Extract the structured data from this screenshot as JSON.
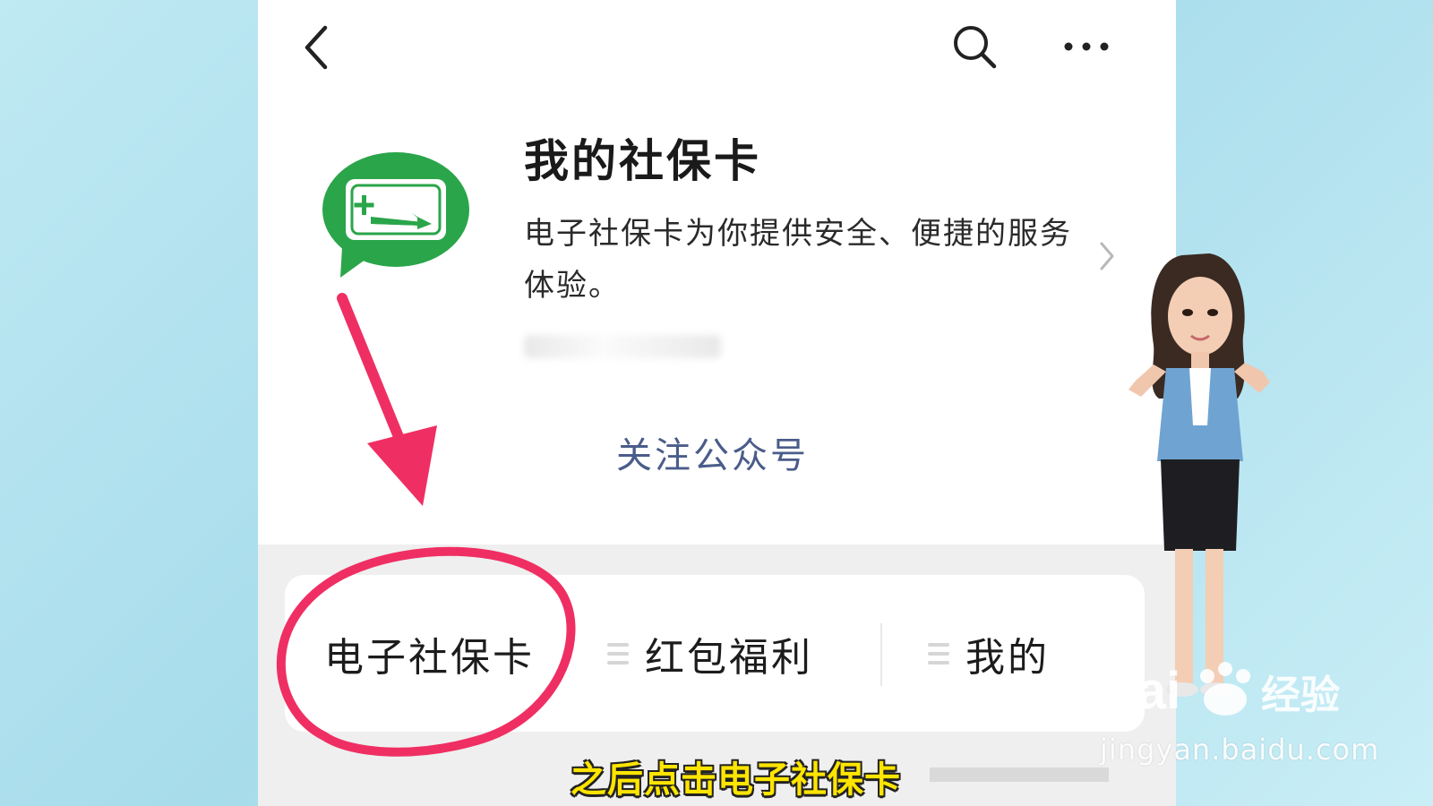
{
  "header": {
    "back_icon": "back-chevron-icon",
    "search_icon": "search-icon",
    "more_icon": "more-dots-icon"
  },
  "account": {
    "name": "我的社保卡",
    "description": "电子社保卡为你提供安全、便捷的服务体验。",
    "follow_label": "关注公众号",
    "logo": "social-security-card-logo",
    "brand_color": "#2aa54a"
  },
  "menu": {
    "tabs": [
      {
        "label": "电子社保卡"
      },
      {
        "label": "红包福利"
      },
      {
        "label": "我的"
      }
    ]
  },
  "annotations": {
    "arrow_color": "#ef2f63",
    "circle_color": "#ef2f63"
  },
  "caption": {
    "text": "之后点击电子社保卡",
    "color": "#ffe500"
  },
  "watermark": {
    "logo_text": "Baidu经验",
    "url": "jingyan.baidu.com"
  }
}
